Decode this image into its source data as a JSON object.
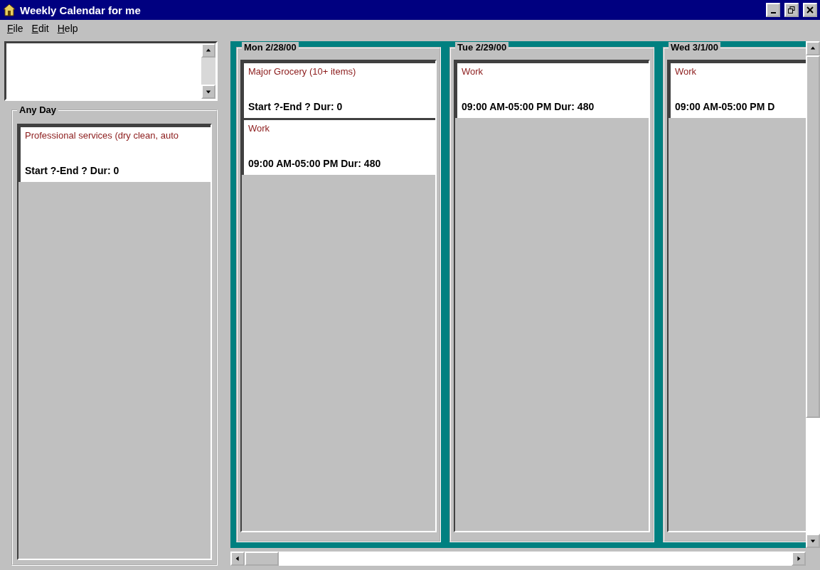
{
  "window": {
    "title": "Weekly Calendar for me"
  },
  "menu": [
    "File",
    "Edit",
    "Help"
  ],
  "any_day": {
    "label": "Any Day",
    "entries": [
      {
        "title": "Professional services (dry clean, auto",
        "time": "Start ?-End ? Dur: 0"
      }
    ]
  },
  "days": [
    {
      "label": "Mon 2/28/00",
      "entries": [
        {
          "title": "Major Grocery (10+ items)",
          "time": "Start ?-End ? Dur: 0"
        },
        {
          "title": "Work",
          "time": "09:00 AM-05:00 PM Dur: 480"
        }
      ]
    },
    {
      "label": "Tue 2/29/00",
      "entries": [
        {
          "title": "Work",
          "time": "09:00 AM-05:00 PM Dur: 480"
        }
      ]
    },
    {
      "label": "Wed 3/1/00",
      "entries": [
        {
          "title": "Work",
          "time": "09:00 AM-05:00 PM D"
        }
      ]
    }
  ]
}
